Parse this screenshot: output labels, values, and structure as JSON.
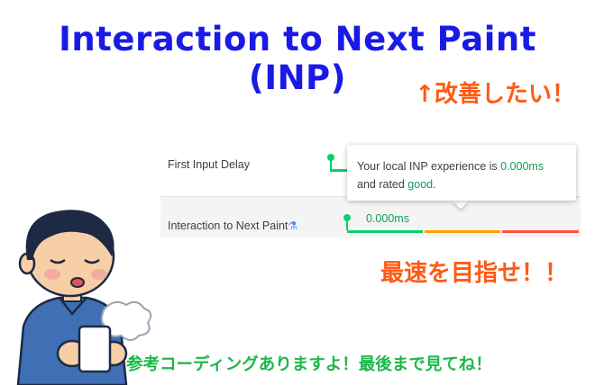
{
  "title": "Interaction to Next Paint (INP)",
  "improve_text": "↑改善したい！",
  "metrics": {
    "fid_label": "First Input Delay",
    "inp_label": "Interaction to Next Paint",
    "flask_icon": "flask-icon",
    "inp_value": "0.000ms",
    "colors": {
      "good": "#0cce6b",
      "needs_improvement": "#ffa400",
      "poor": "#ff4e42"
    }
  },
  "tooltip": {
    "line1_prefix": "Your local INP experience is ",
    "line1_value": "0.000ms",
    "line2_prefix": "and rated ",
    "line2_rating": "good",
    "line2_suffix": "."
  },
  "fastest_text": "最速を目指せ！！",
  "bottom_text": "参考コーディングありますよ！最後まで見てね！",
  "illustration": {
    "icon": "man-drinking-coffee-illustration"
  }
}
